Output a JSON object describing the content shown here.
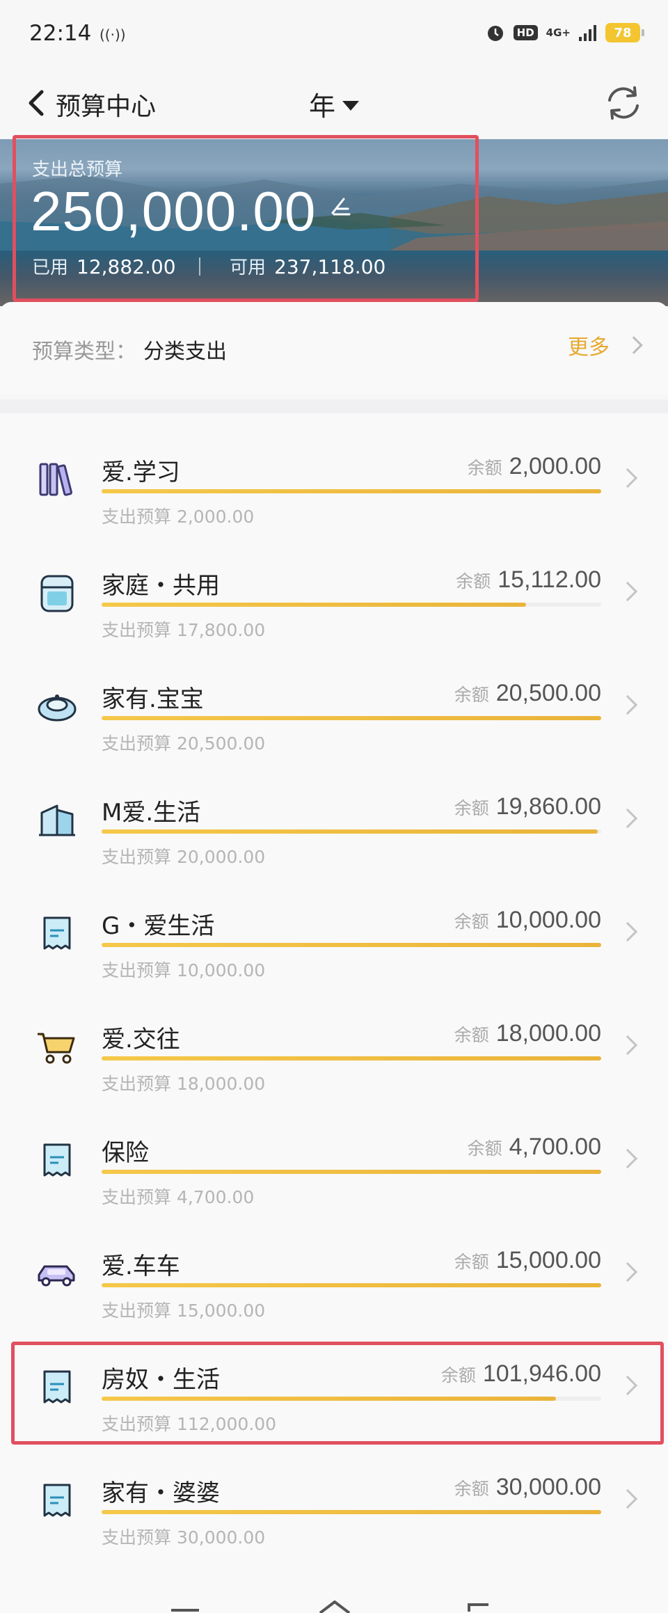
{
  "status_bar": {
    "time": "22:14",
    "network": "4G+",
    "hd": "HD",
    "battery": "78"
  },
  "header": {
    "back_label": "预算中心",
    "period": "年"
  },
  "banner": {
    "label": "支出总预算",
    "amount": "250,000.00",
    "used_label": "已用",
    "used_value": "12,882.00",
    "available_label": "可用",
    "available_value": "237,118.00"
  },
  "budget_type": {
    "label": "预算类型：",
    "value": "分类支出",
    "more": "更多"
  },
  "items": [
    {
      "name": "爱.学习",
      "remain_label": "余额",
      "remain": "2,000.00",
      "budget": "支出预算 2,000.00",
      "progress": 1.0,
      "icon": "books-icon"
    },
    {
      "name": "家庭・共用",
      "remain_label": "余额",
      "remain": "15,112.00",
      "budget": "支出预算 17,800.00",
      "progress": 0.849,
      "icon": "washing-machine-icon"
    },
    {
      "name": "家有.宝宝",
      "remain_label": "余额",
      "remain": "20,500.00",
      "budget": "支出预算 20,500.00",
      "progress": 1.0,
      "icon": "baby-cap-icon"
    },
    {
      "name": "M爱.生活",
      "remain_label": "余额",
      "remain": "19,860.00",
      "budget": "支出预算 20,000.00",
      "progress": 0.993,
      "icon": "building-icon"
    },
    {
      "name": "G・爱生活",
      "remain_label": "余额",
      "remain": "10,000.00",
      "budget": "支出预算 10,000.00",
      "progress": 1.0,
      "icon": "receipt-icon"
    },
    {
      "name": "爱.交往",
      "remain_label": "余额",
      "remain": "18,000.00",
      "budget": "支出预算 18,000.00",
      "progress": 1.0,
      "icon": "shopping-cart-icon"
    },
    {
      "name": "保险",
      "remain_label": "余额",
      "remain": "4,700.00",
      "budget": "支出预算 4,700.00",
      "progress": 1.0,
      "icon": "receipt-icon"
    },
    {
      "name": "爱.车车",
      "remain_label": "余额",
      "remain": "15,000.00",
      "budget": "支出预算 15,000.00",
      "progress": 1.0,
      "icon": "car-icon"
    },
    {
      "name": "房奴・生活",
      "remain_label": "余额",
      "remain": "101,946.00",
      "budget": "支出预算 112,000.00",
      "progress": 0.91,
      "icon": "receipt-icon"
    },
    {
      "name": "家有・婆婆",
      "remain_label": "余额",
      "remain": "30,000.00",
      "budget": "支出预算 30,000.00",
      "progress": 1.0,
      "icon": "receipt-icon"
    }
  ],
  "colors": {
    "accent": "#e8a82e",
    "progress": "#eab43a",
    "highlight": "#e0505f"
  }
}
